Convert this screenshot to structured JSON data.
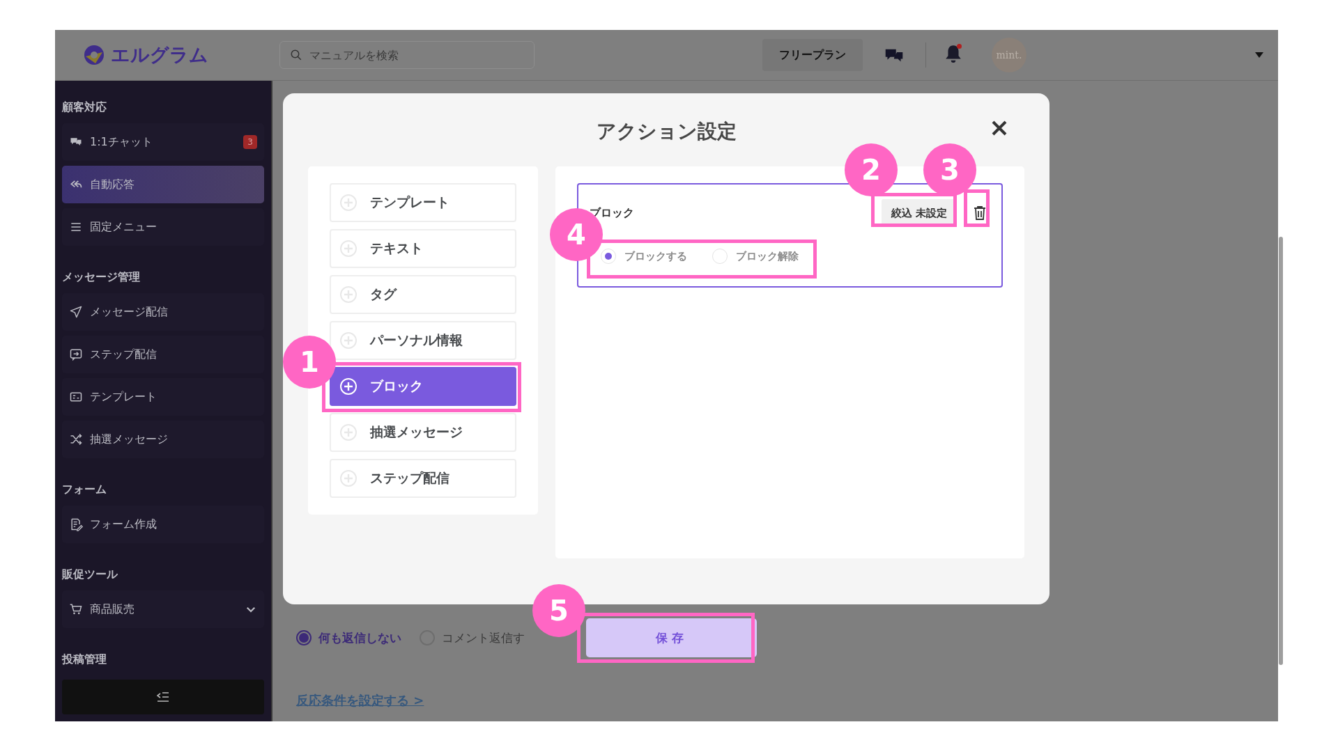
{
  "header": {
    "logo_text": "エルグラム",
    "search": {
      "placeholder": "マニュアルを検索"
    },
    "plan_button": "フリープラン",
    "notification_dot": true,
    "avatar_text": "mint."
  },
  "sidebar": {
    "sections": [
      {
        "title": "顧客対応",
        "items": [
          {
            "label": "1:1チャット",
            "badge": "3",
            "selected": false
          },
          {
            "label": "自動応答",
            "selected": true
          },
          {
            "label": "固定メニュー",
            "selected": false
          }
        ]
      },
      {
        "title": "メッセージ管理",
        "items": [
          {
            "label": "メッセージ配信",
            "selected": false
          },
          {
            "label": "ステップ配信",
            "selected": false
          },
          {
            "label": "テンプレート",
            "selected": false
          },
          {
            "label": "抽選メッセージ",
            "selected": false
          }
        ]
      },
      {
        "title": "フォーム",
        "items": [
          {
            "label": "フォーム作成",
            "selected": false
          }
        ]
      },
      {
        "title": "販促ツール",
        "items": [
          {
            "label": "商品販売",
            "selected": false,
            "expanded": false
          }
        ]
      },
      {
        "title": "投稿管理"
      }
    ]
  },
  "content": {
    "reply_options": [
      {
        "label": "何も返信しない",
        "selected": true
      },
      {
        "label": "コメント返信す",
        "selected": false
      }
    ],
    "save_button": "保存",
    "link": "反応条件を設定する >"
  },
  "modal": {
    "title": "アクション設定",
    "action_types": [
      {
        "label": "テンプレート",
        "selected": false
      },
      {
        "label": "テキスト",
        "selected": false
      },
      {
        "label": "タグ",
        "selected": false
      },
      {
        "label": "パーソナル情報",
        "selected": false
      },
      {
        "label": "ブロック",
        "selected": true
      },
      {
        "label": "抽選メッセージ",
        "selected": false
      },
      {
        "label": "ステップ配信",
        "selected": false
      }
    ],
    "action_card": {
      "title": "ブロック",
      "filter_button": "絞込 未設定",
      "options": [
        {
          "label": "ブロックする",
          "selected": true
        },
        {
          "label": "ブロック解除",
          "selected": false
        }
      ]
    }
  },
  "annotations": [
    {
      "label": "1"
    },
    {
      "label": "2"
    },
    {
      "label": "3"
    },
    {
      "label": "4"
    },
    {
      "label": "5"
    }
  ]
}
